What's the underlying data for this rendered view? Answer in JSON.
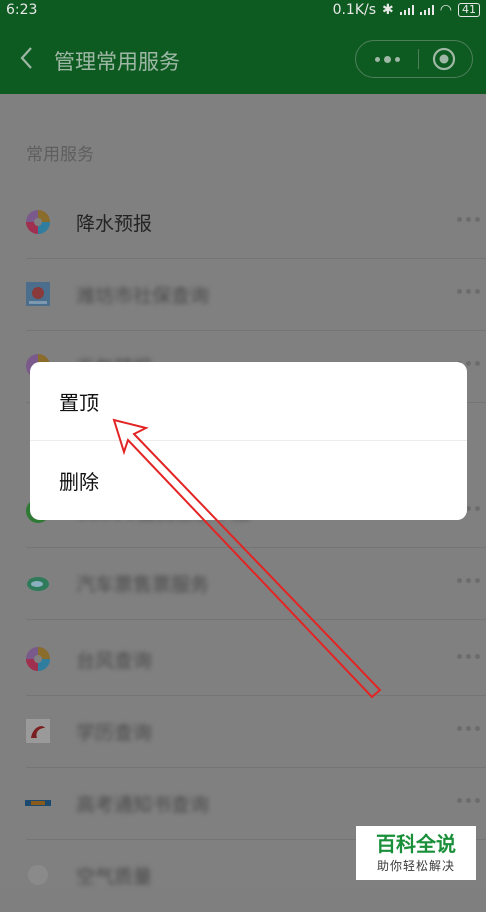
{
  "status_bar": {
    "time": "6:23",
    "network_speed": "0.1K/s",
    "battery": "41"
  },
  "header": {
    "title": "管理常用服务",
    "back_icon": "chevron-left-icon",
    "more_icon": "more-dots-icon",
    "close_icon": "target-circle-icon"
  },
  "section": {
    "label": "常用服务"
  },
  "services": [
    {
      "label": "降水预报",
      "icon": "colorful-pinwheel-icon",
      "blurred": false
    },
    {
      "label": "潍坊市社保查询",
      "icon": "government-emblem-icon",
      "blurred": true
    },
    {
      "label": "天气预报",
      "icon": "colorful-pinwheel-icon",
      "blurred": true
    },
    {
      "label": "12321骚扰信息举报",
      "icon": "green-ring-icon",
      "blurred": true
    },
    {
      "label": "汽车票售票服务",
      "icon": "bus-ticket-icon",
      "blurred": true
    },
    {
      "label": "台风查询",
      "icon": "colorful-pinwheel-icon",
      "blurred": true
    },
    {
      "label": "学历查询",
      "icon": "education-icon",
      "blurred": true
    },
    {
      "label": "高考通知书查询",
      "icon": "ems-logo-icon",
      "blurred": true
    },
    {
      "label": "空气质量",
      "icon": "air-quality-icon",
      "blurred": true
    }
  ],
  "popup": {
    "pin_label": "置顶",
    "delete_label": "删除"
  },
  "watermark": {
    "title": "百科全说",
    "subtitle": "助你轻松解决"
  },
  "colors": {
    "header_bg": "#0e5b22",
    "arrow": "#e32424",
    "watermark_green": "#1a8f3a"
  }
}
